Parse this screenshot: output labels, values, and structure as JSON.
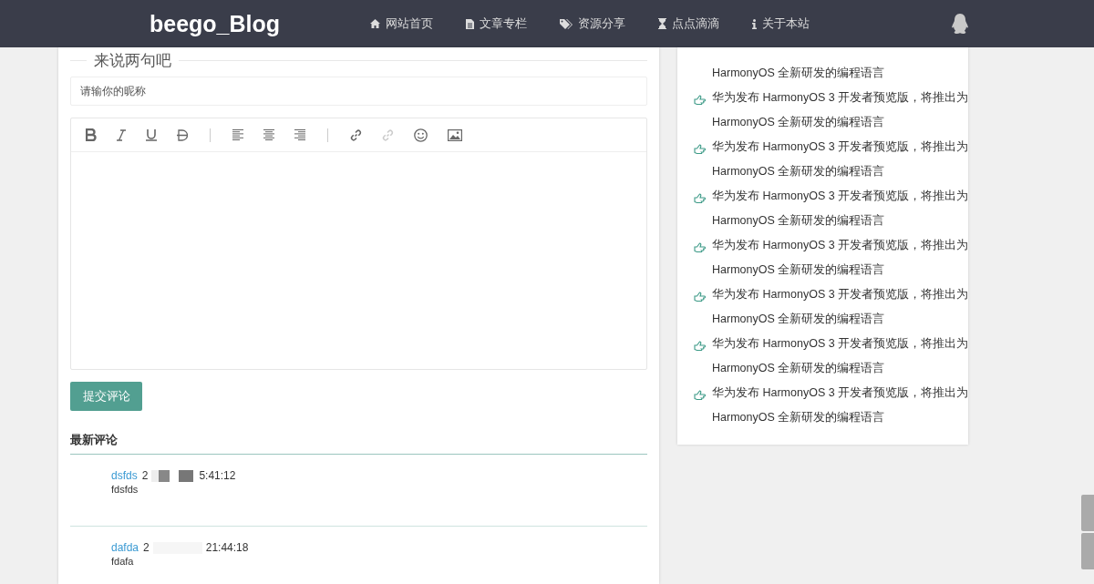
{
  "navbar": {
    "brand": "beego_Blog",
    "items": [
      {
        "kind": "home",
        "label": "网站首页"
      },
      {
        "kind": "file",
        "label": "文章专栏"
      },
      {
        "kind": "tags",
        "label": "资源分享"
      },
      {
        "kind": "hourglass",
        "label": "点点滴滴"
      },
      {
        "kind": "info",
        "label": "关于本站"
      }
    ]
  },
  "comment_form": {
    "title": "来说两句吧",
    "nickname": {
      "placeholder": "请输你的昵称"
    },
    "toolbar": [
      {
        "kind": "bold"
      },
      {
        "kind": "italic"
      },
      {
        "kind": "underline"
      },
      {
        "kind": "strike"
      },
      {
        "kind": "divider"
      },
      {
        "kind": "align-left"
      },
      {
        "kind": "align-center"
      },
      {
        "kind": "align-right"
      },
      {
        "kind": "divider"
      },
      {
        "kind": "link"
      },
      {
        "kind": "unlink",
        "disabled": true
      },
      {
        "kind": "emoji"
      },
      {
        "kind": "image"
      }
    ],
    "submit": "提交评论"
  },
  "latest_comments": {
    "title": "最新评论",
    "items": [
      {
        "name": "dsfds",
        "date_start": "2",
        "date_end": "5:41:12",
        "text": "fdsfds"
      },
      {
        "name": "dafda",
        "date_start": "2",
        "date_end": "21:44:18",
        "text": "fdafa"
      }
    ]
  },
  "sidebar": {
    "items": [
      {
        "lines": [
          "HarmonyOS 全新研发的编程语言"
        ],
        "partial": true
      },
      {
        "lines": [
          "华为发布 HarmonyOS 3 开发者预览版，将推出为",
          "HarmonyOS 全新研发的编程语言"
        ],
        "partial": false
      },
      {
        "lines": [
          "华为发布 HarmonyOS 3 开发者预览版，将推出为",
          "HarmonyOS 全新研发的编程语言"
        ],
        "partial": false
      },
      {
        "lines": [
          "华为发布 HarmonyOS 3 开发者预览版，将推出为",
          "HarmonyOS 全新研发的编程语言"
        ],
        "partial": false
      },
      {
        "lines": [
          "华为发布 HarmonyOS 3 开发者预览版，将推出为",
          "HarmonyOS 全新研发的编程语言"
        ],
        "partial": false
      },
      {
        "lines": [
          "华为发布 HarmonyOS 3 开发者预览版，将推出为",
          "HarmonyOS 全新研发的编程语言"
        ],
        "partial": false
      },
      {
        "lines": [
          "华为发布 HarmonyOS 3 开发者预览版，将推出为",
          "HarmonyOS 全新研发的编程语言"
        ],
        "partial": false
      },
      {
        "lines": [
          "华为发布 HarmonyOS 3 开发者预览版，将推出为",
          "HarmonyOS 全新研发的编程语言"
        ],
        "partial": false
      }
    ]
  }
}
